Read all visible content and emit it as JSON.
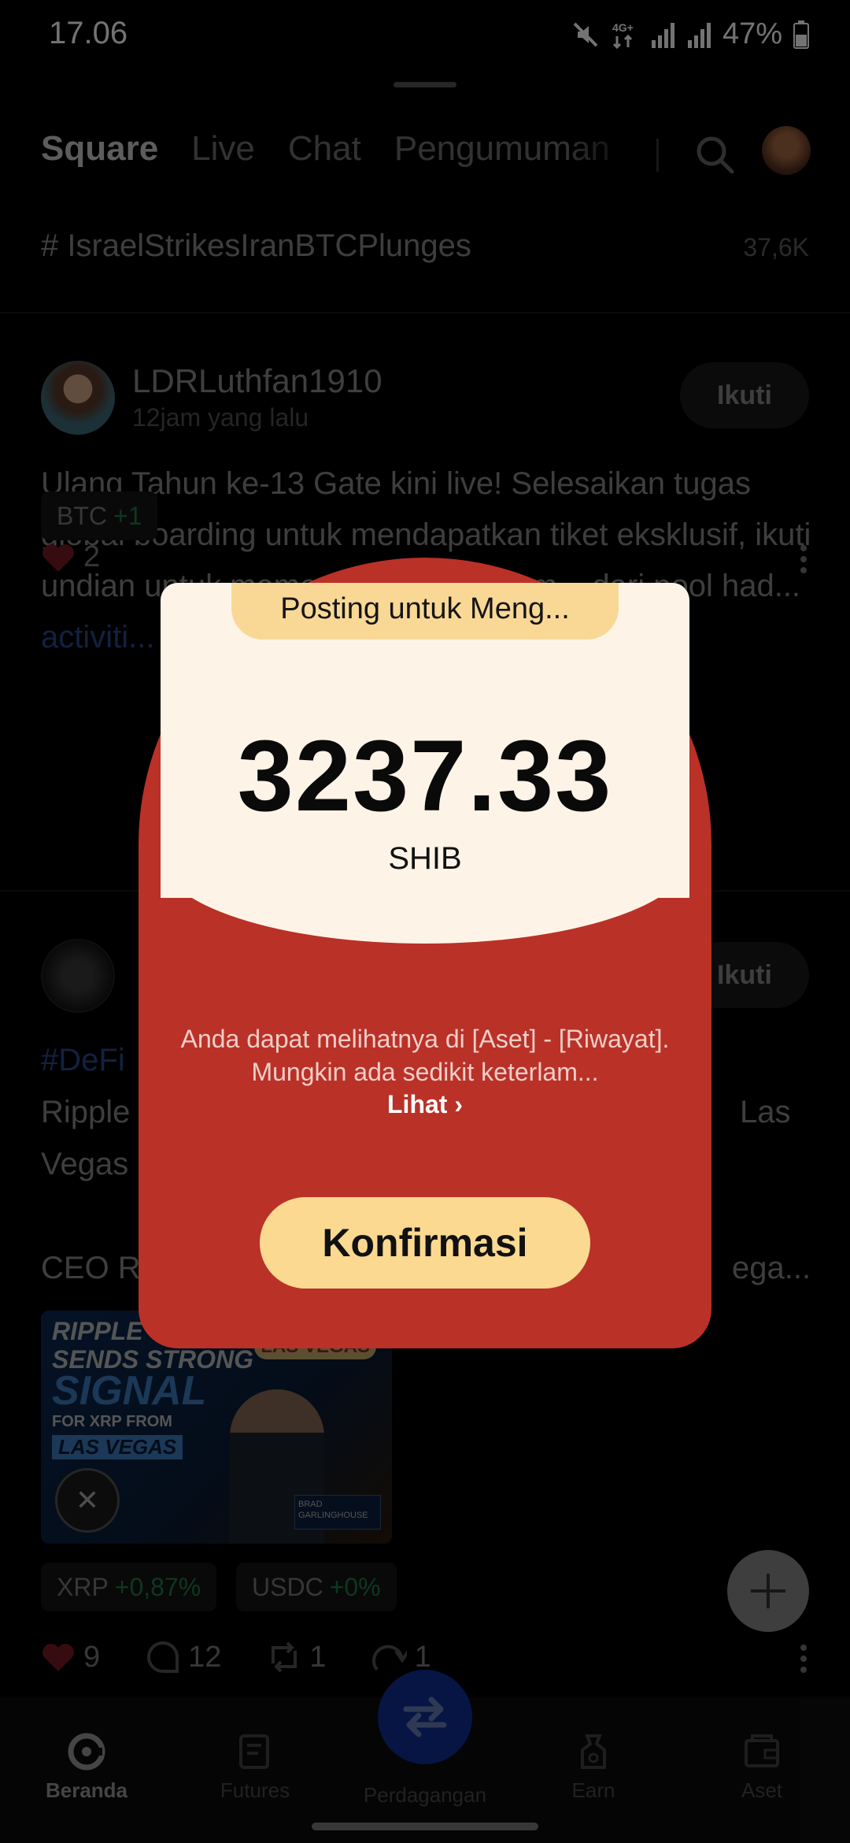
{
  "status_bar": {
    "time": "17.06",
    "network": "4G+",
    "battery": "47%"
  },
  "header": {
    "tabs": [
      "Square",
      "Live",
      "Chat",
      "Pengumuman"
    ],
    "active_tab": "Square"
  },
  "trending": {
    "tag": "# IsraelStrikesIranBTCPlunges",
    "count": "37,6K"
  },
  "post1": {
    "username": "LDRLuthfan1910",
    "time": "12jam yang lalu",
    "follow_label": "Ikuti",
    "body": "Ulang Tahun ke-13 Gate kini live! Selesaikan tugas global boarding untuk mendapatkan tiket eksklusif, ikuti undian untuk memenangkan tiket em... dari pool had...",
    "link": "activiti...",
    "chip": {
      "symbol": "BTC",
      "change": "+1"
    },
    "likes": "2"
  },
  "post2": {
    "follow_label": "Ikuti",
    "hashtag": "#DeFi",
    "line1_start": "Ripple",
    "line1_end": "Las",
    "line2": "Vegas",
    "line3_start": "CEO R",
    "line3_end": "ega...",
    "thumb": {
      "line1": "RIPPLE",
      "line1b": "SENDS STRONG",
      "line2": "SIGNAL",
      "line3": "FOR XRP FROM",
      "line4": "LAS VEGAS",
      "coin": "XRP",
      "vegas": "LAS VEGAS",
      "name": "BRAD GARLINGHOUSE"
    },
    "chips": [
      {
        "symbol": "XRP",
        "change": "+0,87%"
      },
      {
        "symbol": "USDC",
        "change": "+0%"
      }
    ],
    "likes": "9",
    "comments": "12",
    "reposts": "1",
    "shares": "1"
  },
  "modal": {
    "tag": "Posting untuk Meng...",
    "amount": "3237.33",
    "unit": "SHIB",
    "info": "Anda dapat melihatnya di [Aset] - [Riwayat]. Mungkin ada sedikit keterlam...",
    "view_label": "Lihat ›",
    "confirm_label": "Konfirmasi"
  },
  "bottom_nav": {
    "items": [
      "Beranda",
      "Futures",
      "Perdagangan",
      "Earn",
      "Aset"
    ],
    "active": "Beranda"
  },
  "colors": {
    "modal_red": "#ba3128",
    "modal_card": "#fdf4e7",
    "modal_gold": "#fbd990",
    "trade_blue": "#0e2f96"
  }
}
